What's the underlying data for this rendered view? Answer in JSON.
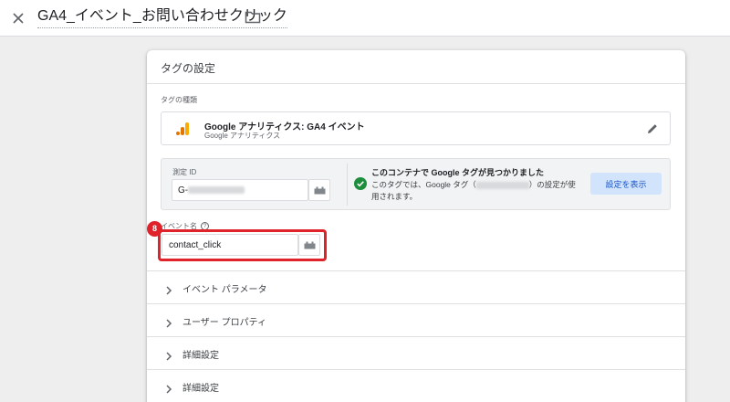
{
  "header": {
    "title": "GA4_イベント_お問い合わせクリック"
  },
  "card": {
    "title": "タグの設定",
    "tag_type_label": "タグの種類",
    "tag_type": {
      "name": "Google アナリティクス: GA4 イベント",
      "subtitle": "Google アナリティクス"
    },
    "measurement": {
      "label": "測定 ID",
      "value_prefix": "G-"
    },
    "notice": {
      "title": "このコンテナで Google タグが見つかりました",
      "desc_before": "このタグでは、Google タグ（",
      "desc_after": "）の設定が使用されます。",
      "button": "設定を表示"
    },
    "event": {
      "label": "イベント名",
      "value": "contact_click",
      "step_number": "8"
    },
    "sections": [
      {
        "label": "イベント パラメータ"
      },
      {
        "label": "ユーザー プロパティ"
      },
      {
        "label": "詳細設定"
      },
      {
        "label": "詳細設定"
      }
    ]
  },
  "colors": {
    "highlight": "#e0222a",
    "accent_button_bg": "#d2e3fc",
    "accent_button_text": "#1a55c8",
    "success": "#1e8e3e",
    "ga_orange": "#f9ab00",
    "ga_dark_orange": "#e37400"
  },
  "icons": [
    "close-icon",
    "folder-icon",
    "google-analytics-icon",
    "pencil-icon",
    "variable-icon",
    "check-circle-icon",
    "help-icon",
    "chevron-right-icon"
  ]
}
